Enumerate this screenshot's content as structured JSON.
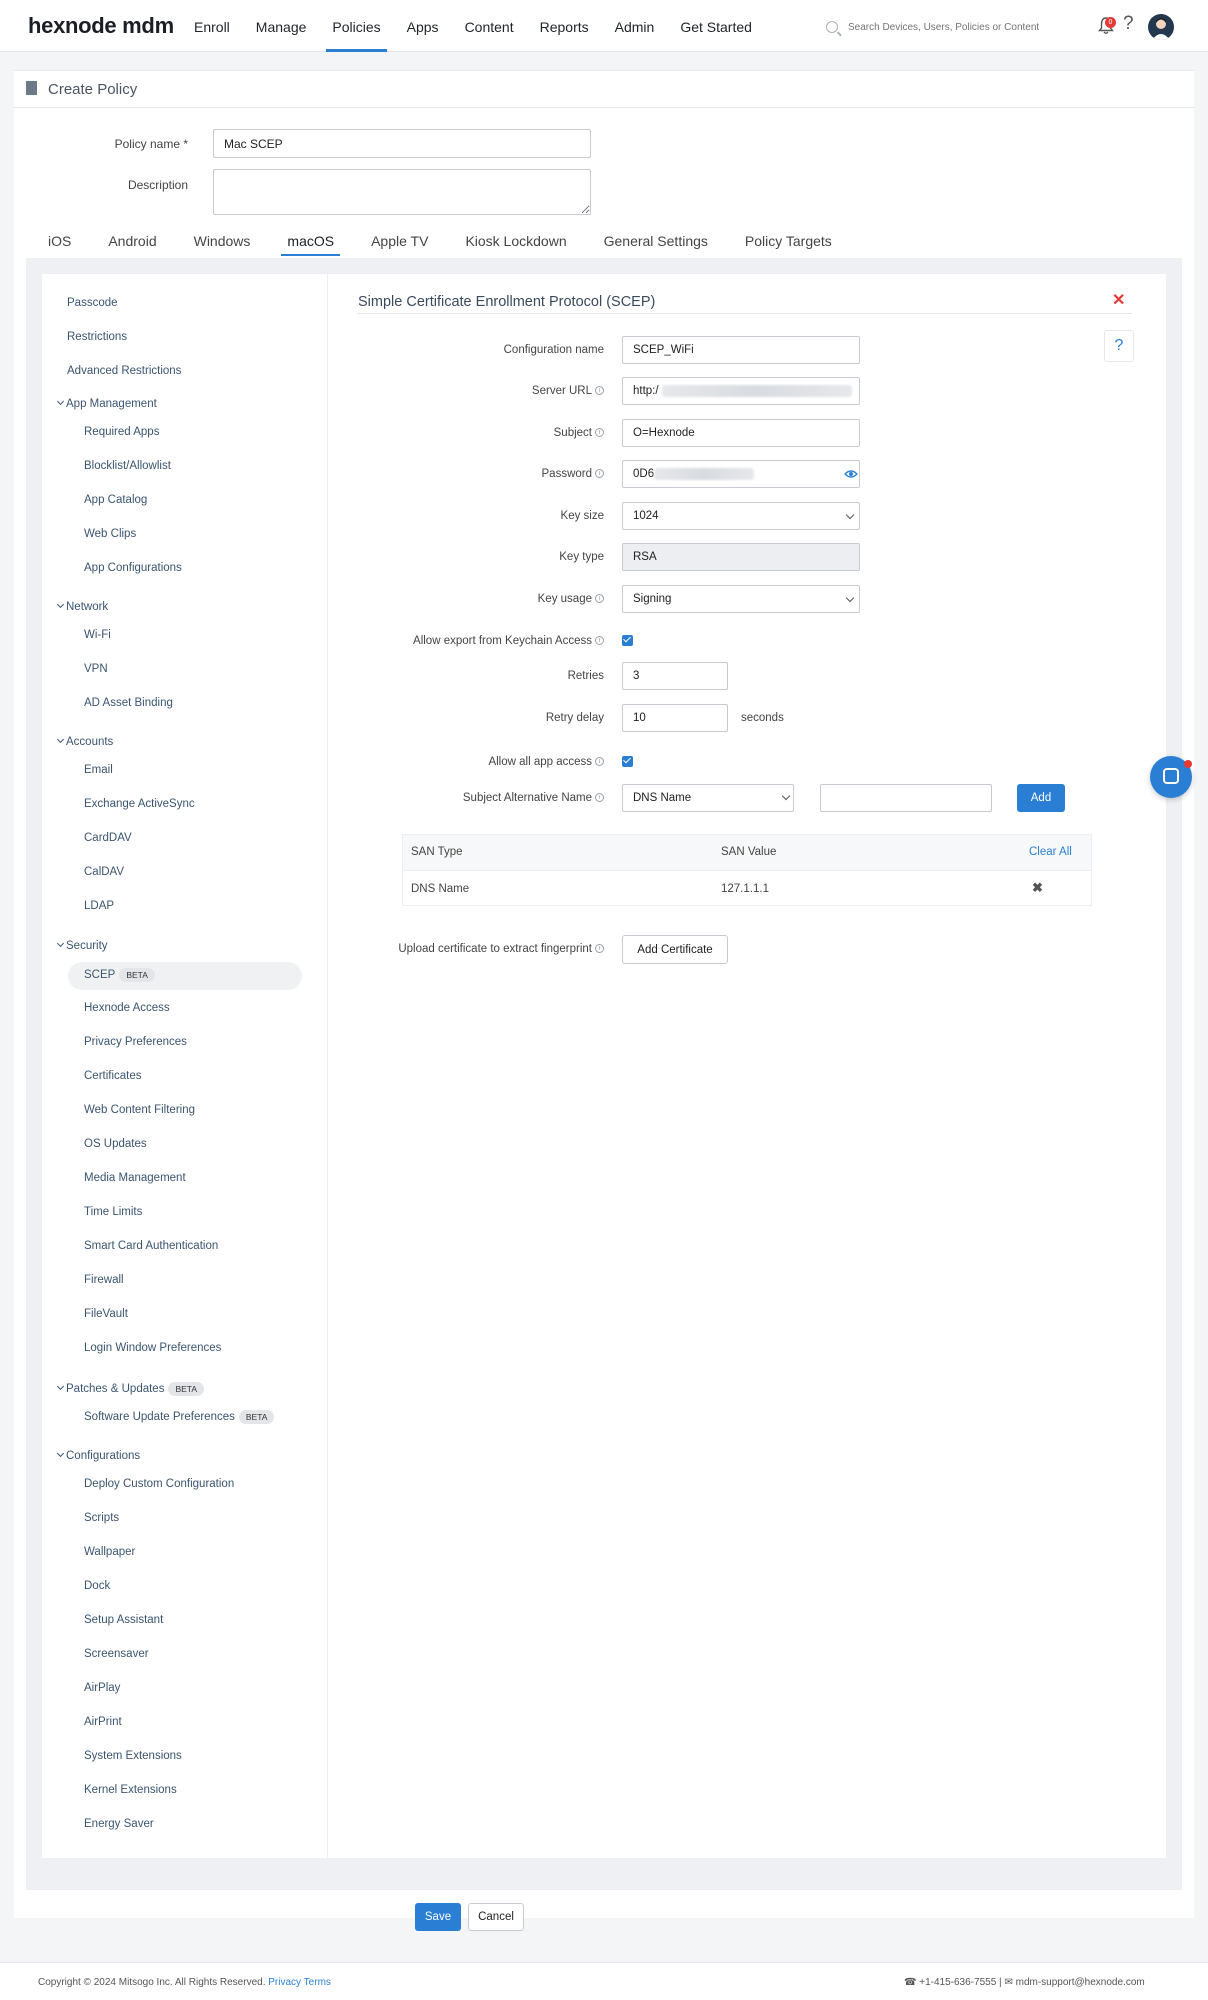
{
  "app": {
    "logo": "hexnode mdm"
  },
  "nav": {
    "items": [
      "Enroll",
      "Manage",
      "Policies",
      "Apps",
      "Content",
      "Reports",
      "Admin",
      "Get Started"
    ],
    "active": "Policies"
  },
  "search": {
    "placeholder": "Search Devices, Users, Policies or Content"
  },
  "notifications": {
    "count": "0"
  },
  "page": {
    "title": "Create Policy"
  },
  "policy": {
    "name_label": "Policy name *",
    "name_value": "Mac SCEP",
    "description_label": "Description",
    "description_value": ""
  },
  "platform_tabs": {
    "items": [
      "iOS",
      "Android",
      "Windows",
      "macOS",
      "Apple TV",
      "Kiosk Lockdown",
      "General Settings",
      "Policy Targets"
    ],
    "active": "macOS"
  },
  "sidebar": {
    "top": [
      "Passcode",
      "Restrictions",
      "Advanced Restrictions"
    ],
    "groups": [
      {
        "title": "App Management",
        "items": [
          "Required Apps",
          "Blocklist/Allowlist",
          "App Catalog",
          "Web Clips",
          "App Configurations"
        ]
      },
      {
        "title": "Network",
        "items": [
          "Wi-Fi",
          "VPN",
          "AD Asset Binding"
        ]
      },
      {
        "title": "Accounts",
        "items": [
          "Email",
          "Exchange ActiveSync",
          "CardDAV",
          "CalDAV",
          "LDAP"
        ]
      },
      {
        "title": "Security",
        "items": [
          "SCEP",
          "Hexnode Access",
          "Privacy Preferences",
          "Certificates",
          "Web Content Filtering",
          "OS Updates",
          "Media Management",
          "Time Limits",
          "Smart Card Authentication",
          "Firewall",
          "FileVault",
          "Login Window Preferences"
        ]
      },
      {
        "title": "Patches & Updates",
        "items": [
          "Software Update Preferences"
        ]
      },
      {
        "title": "Configurations",
        "items": [
          "Deploy Custom Configuration",
          "Scripts",
          "Wallpaper",
          "Dock",
          "Setup Assistant",
          "Screensaver",
          "AirPlay",
          "AirPrint",
          "System Extensions",
          "Kernel Extensions",
          "Energy Saver"
        ]
      }
    ],
    "beta_label": "BETA",
    "active_item": "SCEP"
  },
  "scep": {
    "title": "Simple Certificate Enrollment Protocol (SCEP)",
    "help": "?",
    "fields": {
      "config_name": {
        "label": "Configuration name",
        "value": "SCEP_WiFi"
      },
      "server_url": {
        "label": "Server URL",
        "value": "http:/"
      },
      "subject": {
        "label": "Subject",
        "value": "O=Hexnode"
      },
      "password": {
        "label": "Password",
        "value": "0D6"
      },
      "key_size": {
        "label": "Key size",
        "value": "1024"
      },
      "key_type": {
        "label": "Key type",
        "value": "RSA"
      },
      "key_usage": {
        "label": "Key usage",
        "value": "Signing"
      },
      "allow_export": {
        "label": "Allow export from Keychain Access",
        "checked": true
      },
      "retries": {
        "label": "Retries",
        "value": "3"
      },
      "retry_delay": {
        "label": "Retry delay",
        "value": "10",
        "unit": "seconds"
      },
      "allow_all_app": {
        "label": "Allow all app access",
        "checked": true
      },
      "san": {
        "label": "Subject Alternative Name",
        "type_value": "DNS Name",
        "value": "",
        "add_label": "Add"
      },
      "upload_cert": {
        "label": "Upload certificate to extract fingerprint",
        "button": "Add Certificate"
      }
    },
    "san_table": {
      "headers": [
        "SAN Type",
        "SAN Value"
      ],
      "clear_all": "Clear All",
      "rows": [
        {
          "type": "DNS Name",
          "value": "127.1.1.1"
        }
      ]
    }
  },
  "actions": {
    "save": "Save",
    "cancel": "Cancel"
  },
  "footer": {
    "copyright": "Copyright © 2024 Mitsogo Inc. All Rights Reserved.",
    "privacy": "Privacy",
    "terms": "Terms",
    "phone": "+1-415-636-7555",
    "separator": "|",
    "email": "mdm-support@hexnode.com"
  },
  "colors": {
    "accent": "#2a7fd4",
    "danger": "#e53935"
  }
}
